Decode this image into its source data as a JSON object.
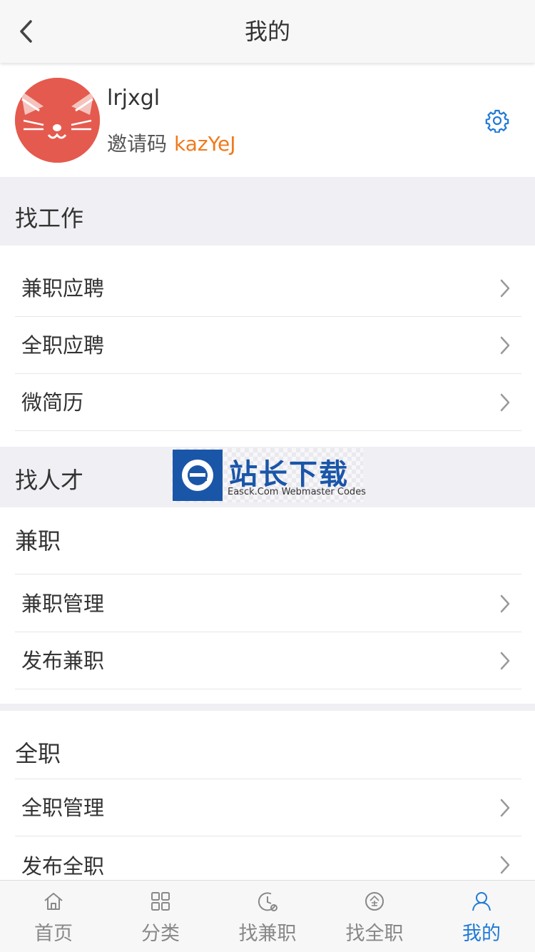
{
  "header": {
    "title": "我的",
    "back_icon": "chevron-left-icon"
  },
  "profile": {
    "username": "lrjxgl",
    "invite_label": "邀请码",
    "invite_code": "kazYeJ",
    "avatar_icon": "cat-avatar",
    "settings_icon": "gear-icon"
  },
  "find_job": {
    "title": "找工作",
    "items": [
      {
        "label": "兼职应聘"
      },
      {
        "label": "全职应聘"
      },
      {
        "label": "微简历"
      }
    ]
  },
  "find_talent": {
    "title": "找人才",
    "parttime": {
      "title": "兼职",
      "items": [
        {
          "label": "兼职管理"
        },
        {
          "label": "发布兼职"
        }
      ]
    },
    "fulltime": {
      "title": "全职",
      "items": [
        {
          "label": "全职管理"
        },
        {
          "label": "发布全职"
        }
      ]
    }
  },
  "watermark": {
    "cn": "站长下载",
    "en": "Easck.Com Webmaster Codes"
  },
  "tabbar": {
    "active_color": "#1f7ad6",
    "items": [
      {
        "label": "首页",
        "icon": "home-icon"
      },
      {
        "label": "分类",
        "icon": "grid-icon"
      },
      {
        "label": "找兼职",
        "icon": "clock-icon"
      },
      {
        "label": "找全职",
        "icon": "full-time-icon"
      },
      {
        "label": "我的",
        "icon": "user-icon",
        "active": true
      }
    ]
  },
  "colors": {
    "accent": "#1f7ad6",
    "invite_code": "#f07a1c",
    "avatar_bg": "#e55a4e",
    "section_bg": "#efeff4"
  }
}
